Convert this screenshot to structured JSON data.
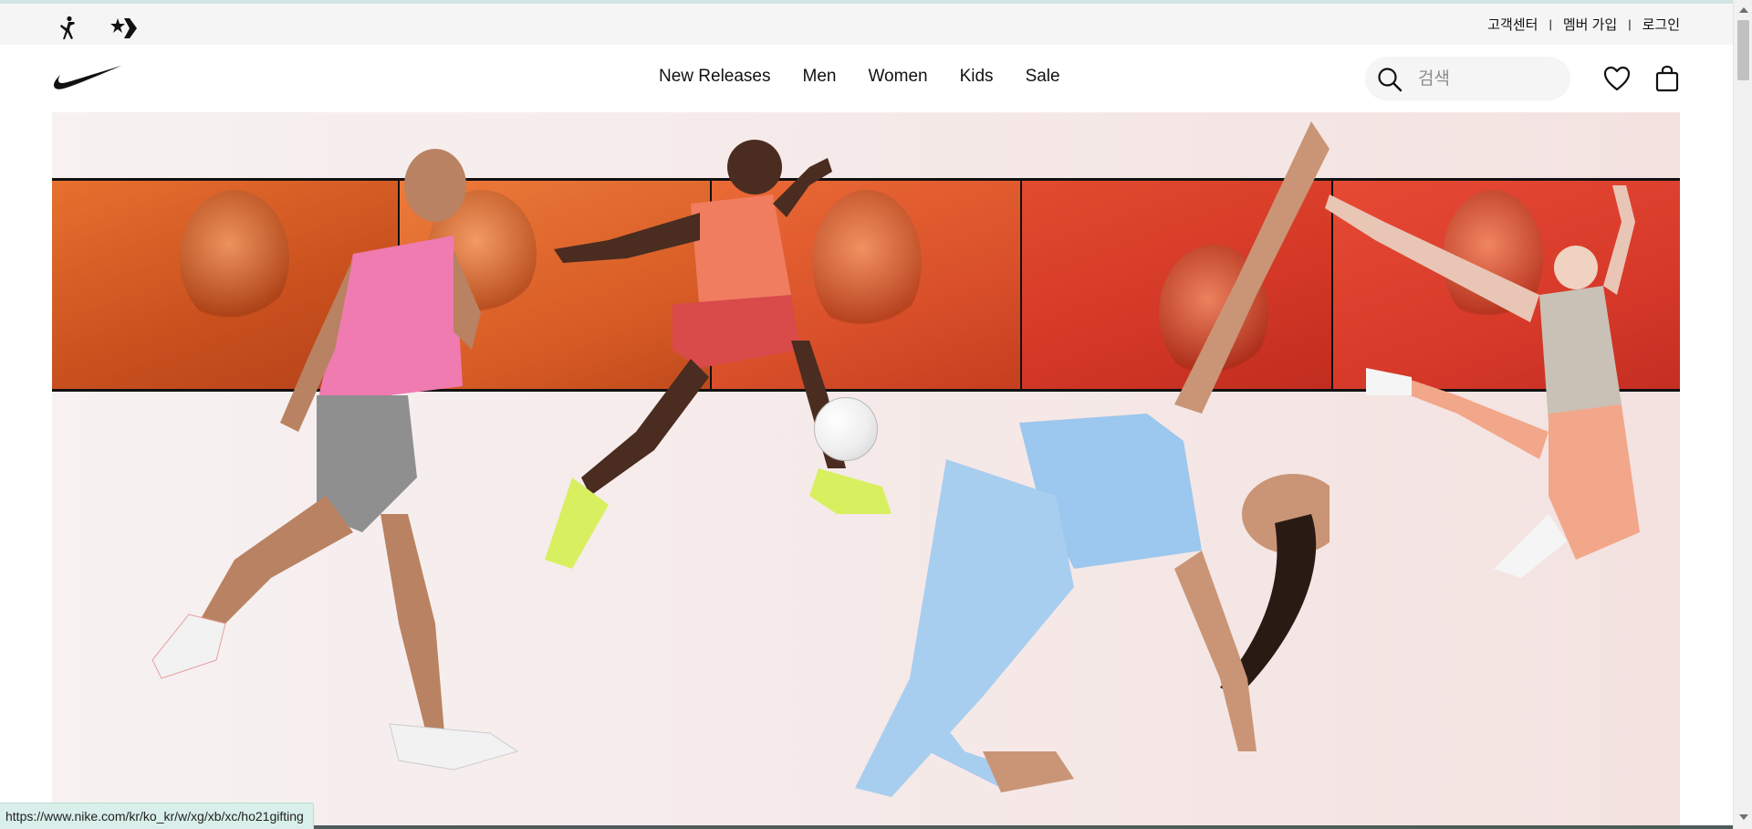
{
  "utility_bar": {
    "brands": [
      {
        "name": "jordan-icon"
      },
      {
        "name": "converse-icon"
      }
    ],
    "links": [
      "고객센터",
      "멤버 가입",
      "로그인"
    ],
    "separator": "|"
  },
  "header": {
    "logo": "nike-swoosh-icon",
    "nav": [
      "New Releases",
      "Men",
      "Women",
      "Kids",
      "Sale"
    ],
    "search_placeholder": "검색",
    "icons": [
      "search-icon",
      "heart-icon",
      "bag-icon"
    ]
  },
  "hero": {
    "panel_colors": [
      "#d05a23",
      "#dd6127",
      "#d9512a",
      "#d33a27",
      "#d5392a"
    ]
  },
  "status_bar": {
    "url": "https://www.nike.com/kr/ko_kr/w/xg/xb/xc/ho21gifting"
  }
}
